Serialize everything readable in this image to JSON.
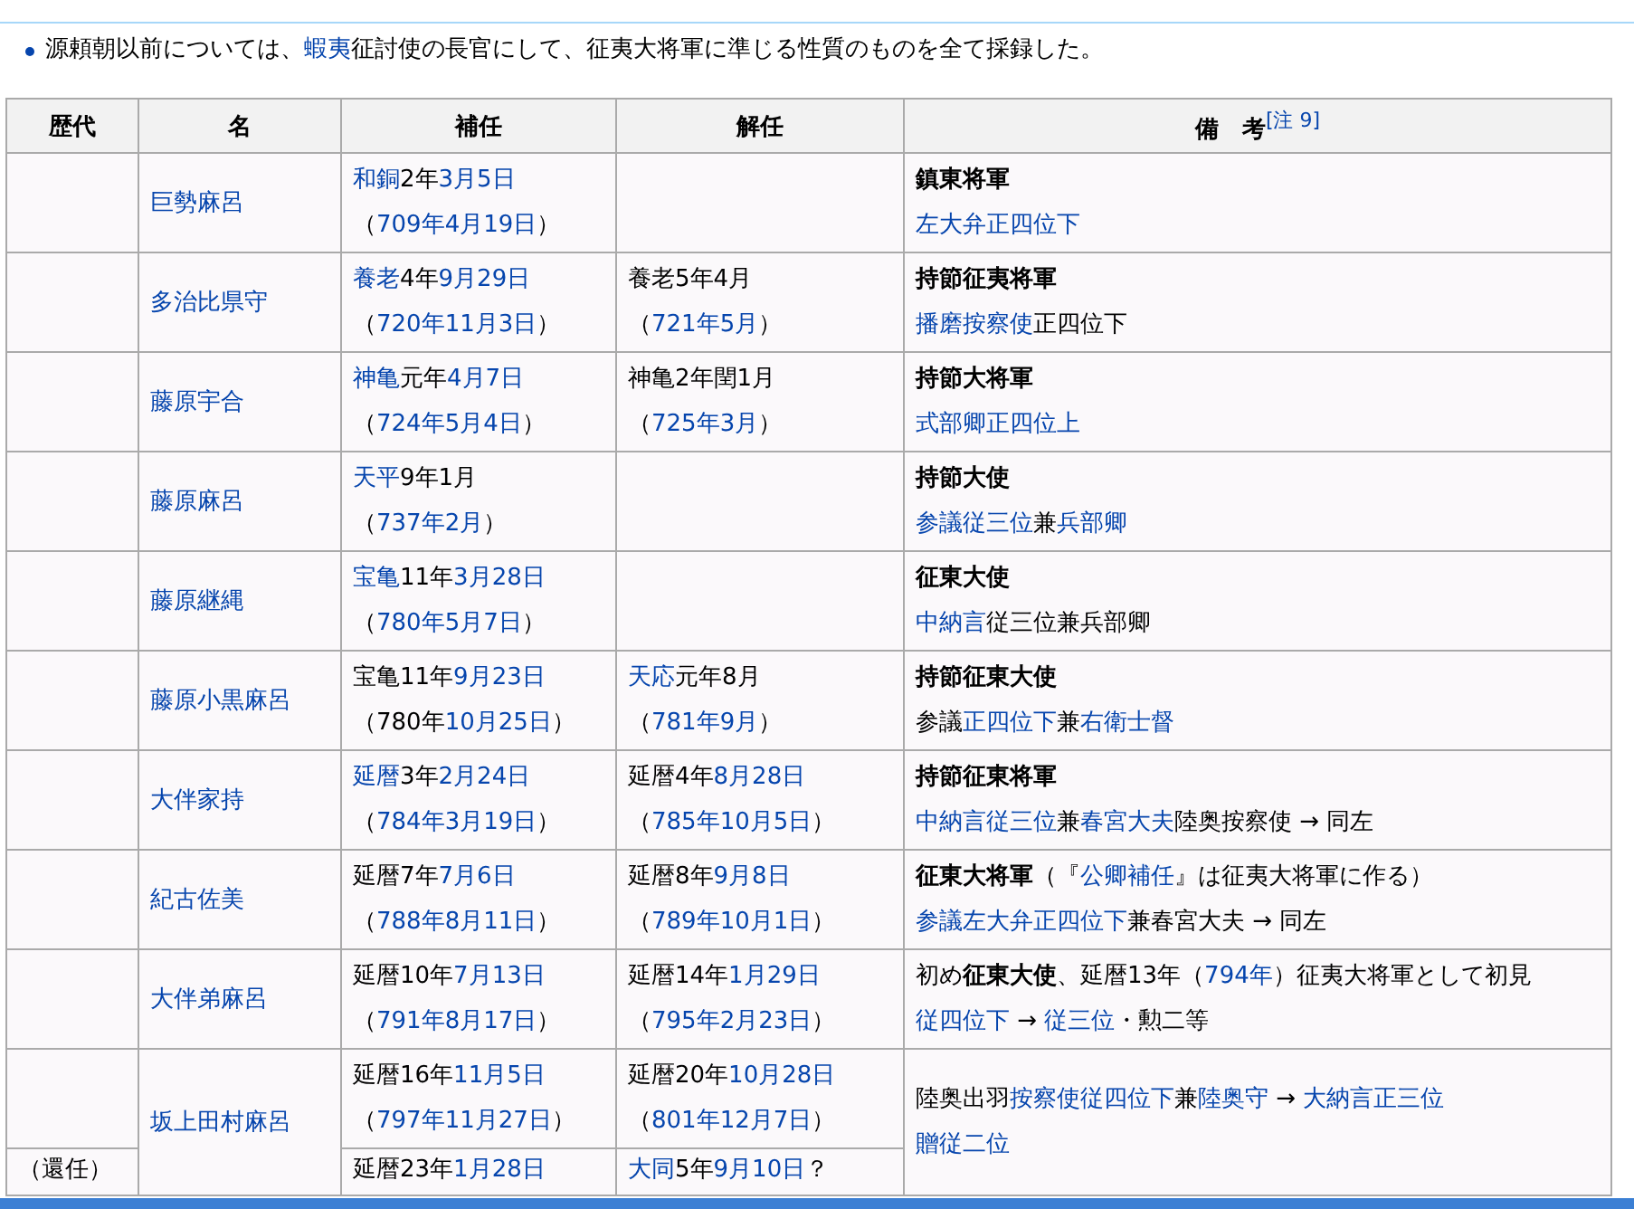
{
  "note": [
    {
      "kind": "plain",
      "text": "源頼朝以前については、"
    },
    {
      "kind": "link",
      "text": "蝦夷"
    },
    {
      "kind": "plain",
      "text": "征討使の長官にして、征夷大将軍に準じる性質のものを全て採録した。"
    }
  ],
  "table": {
    "columns": [
      "歴代",
      "名",
      "補任",
      "解任",
      "備　考"
    ],
    "header_note": "[注 9]",
    "rows": [
      {
        "generation": [],
        "name": [
          [
            {
              "kind": "link",
              "text": "巨勢麻呂"
            }
          ]
        ],
        "appointed": [
          [
            {
              "kind": "link",
              "text": "和銅"
            },
            {
              "kind": "plain",
              "text": "2年"
            },
            {
              "kind": "link",
              "text": "3月5日"
            }
          ],
          [
            {
              "kind": "plain",
              "text": "（"
            },
            {
              "kind": "link",
              "text": "709年4月19日"
            },
            {
              "kind": "plain",
              "text": "）"
            }
          ]
        ],
        "dismissed": [],
        "remarks": [
          [
            {
              "kind": "bold",
              "text": "鎮東将軍"
            }
          ],
          [
            {
              "kind": "link",
              "text": "左大弁正四位下"
            }
          ]
        ]
      },
      {
        "generation": [],
        "name": [
          [
            {
              "kind": "link",
              "text": "多治比県守"
            }
          ]
        ],
        "appointed": [
          [
            {
              "kind": "link",
              "text": "養老"
            },
            {
              "kind": "plain",
              "text": "4年"
            },
            {
              "kind": "link",
              "text": "9月29日"
            }
          ],
          [
            {
              "kind": "plain",
              "text": "（"
            },
            {
              "kind": "link",
              "text": "720年11月3日"
            },
            {
              "kind": "plain",
              "text": "）"
            }
          ]
        ],
        "dismissed": [
          [
            {
              "kind": "plain",
              "text": "養老5年4月"
            }
          ],
          [
            {
              "kind": "plain",
              "text": "（"
            },
            {
              "kind": "link",
              "text": "721年5月"
            },
            {
              "kind": "plain",
              "text": "）"
            }
          ]
        ],
        "remarks": [
          [
            {
              "kind": "bold",
              "text": "持節征夷将軍"
            }
          ],
          [
            {
              "kind": "link",
              "text": "播磨按察使"
            },
            {
              "kind": "plain",
              "text": "正四位下"
            }
          ]
        ]
      },
      {
        "generation": [],
        "name": [
          [
            {
              "kind": "link",
              "text": "藤原宇合"
            }
          ]
        ],
        "appointed": [
          [
            {
              "kind": "link",
              "text": "神亀"
            },
            {
              "kind": "plain",
              "text": "元年"
            },
            {
              "kind": "link",
              "text": "4月7日"
            }
          ],
          [
            {
              "kind": "plain",
              "text": "（"
            },
            {
              "kind": "link",
              "text": "724年5月4日"
            },
            {
              "kind": "plain",
              "text": "）"
            }
          ]
        ],
        "dismissed": [
          [
            {
              "kind": "plain",
              "text": "神亀2年閏1月"
            }
          ],
          [
            {
              "kind": "plain",
              "text": "（"
            },
            {
              "kind": "link",
              "text": "725年3月"
            },
            {
              "kind": "plain",
              "text": "）"
            }
          ]
        ],
        "remarks": [
          [
            {
              "kind": "bold",
              "text": "持節大将軍"
            }
          ],
          [
            {
              "kind": "link",
              "text": "式部卿正四位上"
            }
          ]
        ]
      },
      {
        "generation": [],
        "name": [
          [
            {
              "kind": "link",
              "text": "藤原麻呂"
            }
          ]
        ],
        "appointed": [
          [
            {
              "kind": "link",
              "text": "天平"
            },
            {
              "kind": "plain",
              "text": "9年1月"
            }
          ],
          [
            {
              "kind": "plain",
              "text": "（"
            },
            {
              "kind": "link",
              "text": "737年2月"
            },
            {
              "kind": "plain",
              "text": "）"
            }
          ]
        ],
        "dismissed": [],
        "remarks": [
          [
            {
              "kind": "bold",
              "text": "持節大使"
            }
          ],
          [
            {
              "kind": "link",
              "text": "参議従三位"
            },
            {
              "kind": "plain",
              "text": "兼"
            },
            {
              "kind": "link",
              "text": "兵部卿"
            }
          ]
        ]
      },
      {
        "generation": [],
        "name": [
          [
            {
              "kind": "link",
              "text": "藤原継縄"
            }
          ]
        ],
        "appointed": [
          [
            {
              "kind": "link",
              "text": "宝亀"
            },
            {
              "kind": "plain",
              "text": "11年"
            },
            {
              "kind": "link",
              "text": "3月28日"
            }
          ],
          [
            {
              "kind": "plain",
              "text": "（"
            },
            {
              "kind": "link",
              "text": "780年5月7日"
            },
            {
              "kind": "plain",
              "text": "）"
            }
          ]
        ],
        "dismissed": [],
        "remarks": [
          [
            {
              "kind": "bold",
              "text": "征東大使"
            }
          ],
          [
            {
              "kind": "link",
              "text": "中納言"
            },
            {
              "kind": "plain",
              "text": "従三位兼兵部卿"
            }
          ]
        ]
      },
      {
        "generation": [],
        "name": [
          [
            {
              "kind": "link",
              "text": "藤原小黒麻呂"
            }
          ]
        ],
        "appointed": [
          [
            {
              "kind": "plain",
              "text": "宝亀11年"
            },
            {
              "kind": "link",
              "text": "9月23日"
            }
          ],
          [
            {
              "kind": "plain",
              "text": "（780年"
            },
            {
              "kind": "link",
              "text": "10月25日"
            },
            {
              "kind": "plain",
              "text": "）"
            }
          ]
        ],
        "dismissed": [
          [
            {
              "kind": "link",
              "text": "天応"
            },
            {
              "kind": "plain",
              "text": "元年8月"
            }
          ],
          [
            {
              "kind": "plain",
              "text": "（"
            },
            {
              "kind": "link",
              "text": "781年9月"
            },
            {
              "kind": "plain",
              "text": "）"
            }
          ]
        ],
        "remarks": [
          [
            {
              "kind": "bold",
              "text": "持節征東大使"
            }
          ],
          [
            {
              "kind": "plain",
              "text": "参議"
            },
            {
              "kind": "link",
              "text": "正四位下"
            },
            {
              "kind": "plain",
              "text": "兼"
            },
            {
              "kind": "link",
              "text": "右衛士督"
            }
          ]
        ]
      },
      {
        "generation": [],
        "name": [
          [
            {
              "kind": "link",
              "text": "大伴家持"
            }
          ]
        ],
        "appointed": [
          [
            {
              "kind": "link",
              "text": "延暦"
            },
            {
              "kind": "plain",
              "text": "3年"
            },
            {
              "kind": "link",
              "text": "2月24日"
            }
          ],
          [
            {
              "kind": "plain",
              "text": "（"
            },
            {
              "kind": "link",
              "text": "784年3月19日"
            },
            {
              "kind": "plain",
              "text": "）"
            }
          ]
        ],
        "dismissed": [
          [
            {
              "kind": "plain",
              "text": "延暦4年"
            },
            {
              "kind": "link",
              "text": "8月28日"
            }
          ],
          [
            {
              "kind": "plain",
              "text": "（"
            },
            {
              "kind": "link",
              "text": "785年10月5日"
            },
            {
              "kind": "plain",
              "text": "）"
            }
          ]
        ],
        "remarks": [
          [
            {
              "kind": "bold",
              "text": "持節征東将軍"
            }
          ],
          [
            {
              "kind": "link",
              "text": "中納言従三位"
            },
            {
              "kind": "plain",
              "text": "兼"
            },
            {
              "kind": "link",
              "text": "春宮大夫"
            },
            {
              "kind": "plain",
              "text": "陸奥按察使 → 同左"
            }
          ]
        ]
      },
      {
        "generation": [],
        "name": [
          [
            {
              "kind": "link",
              "text": "紀古佐美"
            }
          ]
        ],
        "appointed": [
          [
            {
              "kind": "plain",
              "text": "延暦7年"
            },
            {
              "kind": "link",
              "text": "7月6日"
            }
          ],
          [
            {
              "kind": "plain",
              "text": "（"
            },
            {
              "kind": "link",
              "text": "788年8月11日"
            },
            {
              "kind": "plain",
              "text": "）"
            }
          ]
        ],
        "dismissed": [
          [
            {
              "kind": "plain",
              "text": "延暦8年"
            },
            {
              "kind": "link",
              "text": "9月8日"
            }
          ],
          [
            {
              "kind": "plain",
              "text": "（"
            },
            {
              "kind": "link",
              "text": "789年10月1日"
            },
            {
              "kind": "plain",
              "text": "）"
            }
          ]
        ],
        "remarks": [
          [
            {
              "kind": "bold",
              "text": "征東大将軍"
            },
            {
              "kind": "plain",
              "text": "（『"
            },
            {
              "kind": "link",
              "text": "公卿補任"
            },
            {
              "kind": "plain",
              "text": "』は征夷大将軍に作る）"
            }
          ],
          [
            {
              "kind": "link",
              "text": "参議左大弁正四位下"
            },
            {
              "kind": "plain",
              "text": "兼春宮大夫 → 同左"
            }
          ]
        ]
      },
      {
        "generation": [],
        "name": [
          [
            {
              "kind": "link",
              "text": "大伴弟麻呂"
            }
          ]
        ],
        "appointed": [
          [
            {
              "kind": "plain",
              "text": "延暦10年"
            },
            {
              "kind": "link",
              "text": "7月13日"
            }
          ],
          [
            {
              "kind": "plain",
              "text": "（"
            },
            {
              "kind": "link",
              "text": "791年8月17日"
            },
            {
              "kind": "plain",
              "text": "）"
            }
          ]
        ],
        "dismissed": [
          [
            {
              "kind": "plain",
              "text": "延暦14年"
            },
            {
              "kind": "link",
              "text": "1月29日"
            }
          ],
          [
            {
              "kind": "plain",
              "text": "（"
            },
            {
              "kind": "link",
              "text": "795年2月23日"
            },
            {
              "kind": "plain",
              "text": "）"
            }
          ]
        ],
        "remarks": [
          [
            {
              "kind": "plain",
              "text": "初め"
            },
            {
              "kind": "bold",
              "text": "征東大使"
            },
            {
              "kind": "plain",
              "text": "、延暦13年（"
            },
            {
              "kind": "link",
              "text": "794年"
            },
            {
              "kind": "plain",
              "text": "）征夷大将軍として初見"
            }
          ],
          [
            {
              "kind": "link",
              "text": "従四位下"
            },
            {
              "kind": "plain",
              "text": " → "
            },
            {
              "kind": "link",
              "text": "従三位"
            },
            {
              "kind": "plain",
              "text": "・勲二等"
            }
          ]
        ]
      },
      {
        "generation": [],
        "name": [
          [
            {
              "kind": "link",
              "text": "坂上田村麻呂"
            }
          ]
        ],
        "appointed": [
          [
            {
              "kind": "plain",
              "text": "延暦16年"
            },
            {
              "kind": "link",
              "text": "11月5日"
            }
          ],
          [
            {
              "kind": "plain",
              "text": "（"
            },
            {
              "kind": "link",
              "text": "797年11月27日"
            },
            {
              "kind": "plain",
              "text": "）"
            }
          ]
        ],
        "dismissed": [
          [
            {
              "kind": "plain",
              "text": "延暦20年"
            },
            {
              "kind": "link",
              "text": "10月28日"
            }
          ],
          [
            {
              "kind": "plain",
              "text": "（"
            },
            {
              "kind": "link",
              "text": "801年12月7日"
            },
            {
              "kind": "plain",
              "text": "）"
            }
          ]
        ],
        "remarks": [
          [
            {
              "kind": "plain",
              "text": "陸奥出羽"
            },
            {
              "kind": "link",
              "text": "按察使従四位下"
            },
            {
              "kind": "plain",
              "text": "兼"
            },
            {
              "kind": "link",
              "text": "陸奥守"
            },
            {
              "kind": "plain",
              "text": " → "
            },
            {
              "kind": "link",
              "text": "大納言正三位"
            }
          ],
          [
            {
              "kind": "link",
              "text": "贈従二位"
            }
          ]
        ],
        "reappointment": {
          "generation": [
            [
              {
                "kind": "plain",
                "text": "（還任）"
              }
            ]
          ],
          "appointed": [
            [
              {
                "kind": "plain",
                "text": "延暦23年"
              },
              {
                "kind": "link",
                "text": "1月28日"
              }
            ]
          ],
          "dismissed": [
            [
              {
                "kind": "link",
                "text": "大同"
              },
              {
                "kind": "plain",
                "text": "5年"
              },
              {
                "kind": "link",
                "text": "9月10日"
              },
              {
                "kind": "plain",
                "text": "？"
              }
            ]
          ]
        }
      }
    ]
  }
}
